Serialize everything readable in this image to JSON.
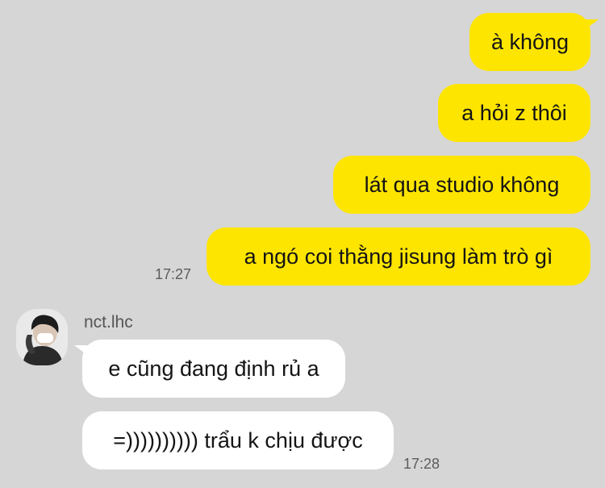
{
  "outgoing": [
    {
      "text": "à không"
    },
    {
      "text": "a hỏi z thôi"
    },
    {
      "text": "lát qua studio không"
    },
    {
      "text": "a ngó coi thằng jisung làm trò gì"
    }
  ],
  "outgoing_time": "17:27",
  "sender": {
    "name": "nct.lhc",
    "avatar_icon": "profile-photo-masked-person"
  },
  "incoming": [
    {
      "text": "e cũng đang định rủ a"
    },
    {
      "text": "=)))))))))) trẩu k chịu được"
    }
  ],
  "incoming_time": "17:28",
  "colors": {
    "background": "#d6d6d6",
    "outgoing_bubble": "#fee500",
    "incoming_bubble": "#ffffff"
  }
}
